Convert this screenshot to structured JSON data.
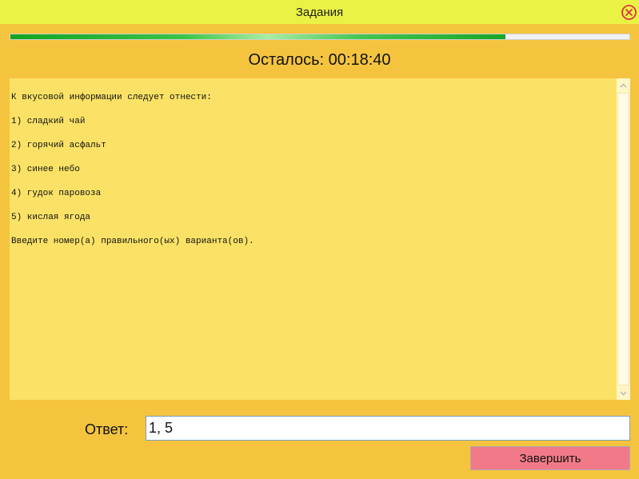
{
  "window": {
    "title": "Задания",
    "close_icon": "close-icon"
  },
  "progress": {
    "fraction": 0.8
  },
  "timer": {
    "text": "Осталось: 00:18:40"
  },
  "question": {
    "intro": "К вкусовой информации следует отнести:",
    "options": [
      "1) сладкий чай",
      "2) горячий асфальт",
      "3) синее небо",
      "4) гудок паровоза",
      "5) кислая ягода"
    ],
    "instruction": "Введите номер(а) правильного(ых) варианта(ов)."
  },
  "answer": {
    "label": "Ответ:",
    "value": "1, 5"
  },
  "buttons": {
    "finish": "Завершить"
  },
  "colors": {
    "background": "#f5c43e",
    "titlebar": "#eaf246",
    "question_bg": "#fbe266",
    "progress_green": "#13a322",
    "finish_button": "#f27a88"
  }
}
